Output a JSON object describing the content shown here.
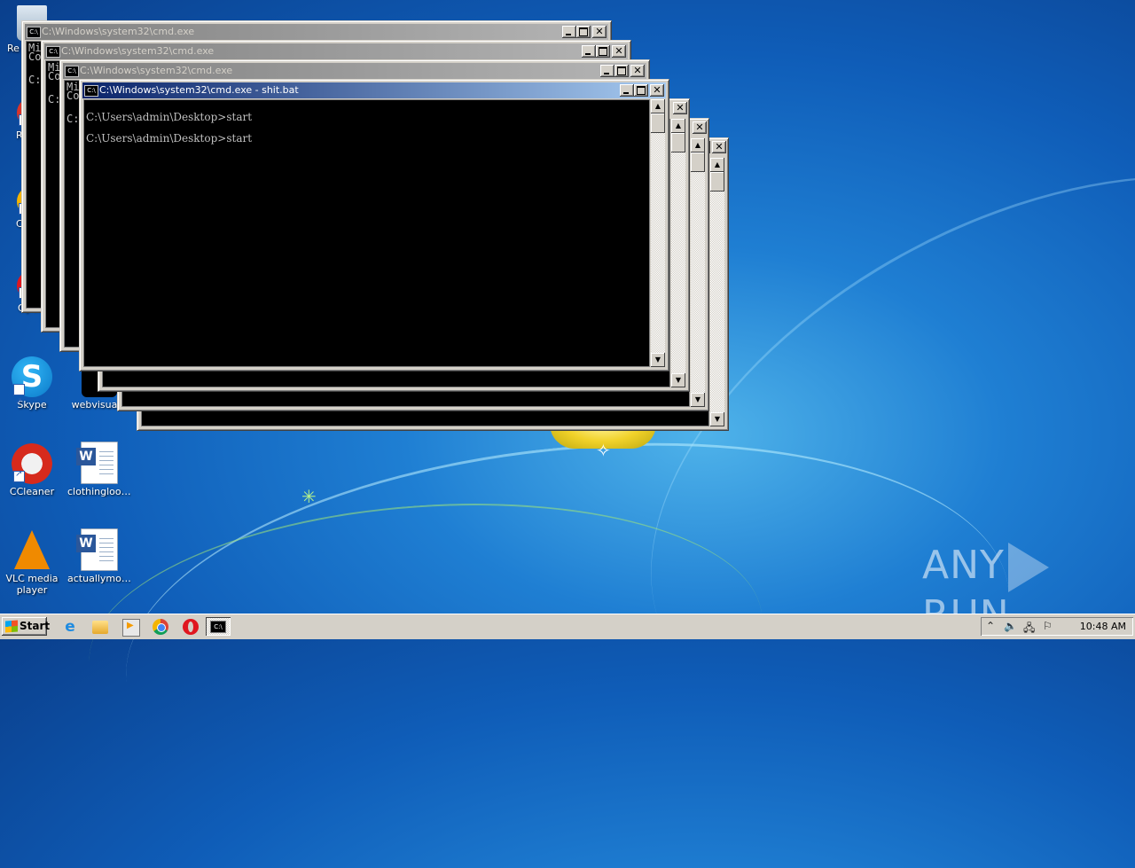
{
  "desktop": {
    "icons": [
      {
        "label": "Re"
      },
      {
        "label": "R"
      },
      {
        "label": "C"
      },
      {
        "label": "Oper"
      },
      {
        "label": "Skype"
      },
      {
        "label": "webvisual.r"
      },
      {
        "label": "CCleaner"
      },
      {
        "label": "clothinglooki..."
      },
      {
        "label": "VLC media player"
      },
      {
        "label": "actuallymont..."
      }
    ]
  },
  "windows": [
    {
      "title": "C:\\Windows\\system32\\cmd.exe",
      "partial_line1": "Mi",
      "partial_line2": "Co",
      "partial_line3": "C:"
    },
    {
      "title": "C:\\Windows\\system32\\cmd.exe",
      "partial_line1": "Mi",
      "partial_line2": "Co",
      "partial_line3": "C:"
    },
    {
      "title": "C:\\Windows\\system32\\cmd.exe",
      "partial_line1": "Mi",
      "partial_line2": "Co",
      "partial_line3": "C:"
    },
    {
      "title": "C:\\Windows\\system32\\cmd.exe - shit.bat",
      "lines": [
        "C:\\Users\\admin\\Desktop>start",
        "C:\\Users\\admin\\Desktop>start"
      ]
    }
  ],
  "taskbar": {
    "start_label": "Start",
    "clock": "10:48 AM"
  },
  "watermark": {
    "left": "ANY",
    "right": "RUN"
  },
  "colors": {
    "titlebar_active": "#0a246a",
    "titlebar_inactive": "#808080",
    "desktop": "#1f7fd3"
  }
}
